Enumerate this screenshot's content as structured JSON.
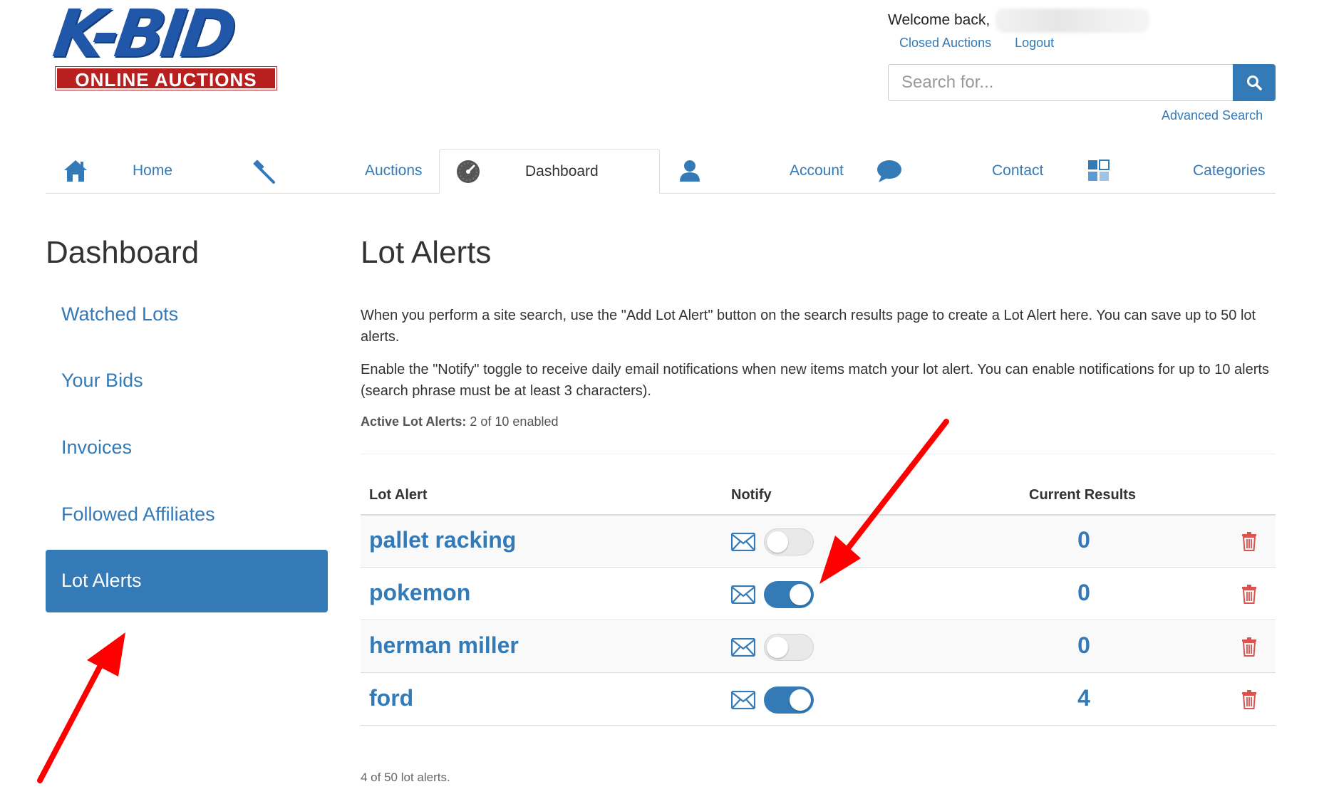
{
  "logo": {
    "main": "K-BID",
    "sub": "ONLINE AUCTIONS"
  },
  "header": {
    "welcome": "Welcome back,",
    "links": {
      "closed": "Closed Auctions",
      "logout": "Logout"
    },
    "search_placeholder": "Search for...",
    "advanced": "Advanced Search"
  },
  "nav": {
    "home": "Home",
    "auctions": "Auctions",
    "dashboard": "Dashboard",
    "account": "Account",
    "contact": "Contact",
    "categories": "Categories"
  },
  "sidebar": {
    "title": "Dashboard",
    "items": [
      {
        "label": "Watched Lots"
      },
      {
        "label": "Your Bids"
      },
      {
        "label": "Invoices"
      },
      {
        "label": "Followed Affiliates"
      },
      {
        "label": "Lot Alerts"
      }
    ],
    "active_index": 4
  },
  "main": {
    "title": "Lot Alerts",
    "para1": "When you perform a site search, use the \"Add Lot Alert\" button on the search results page to create a Lot Alert here. You can save up to 50 lot alerts.",
    "para2": "Enable the \"Notify\" toggle to receive daily email notifications when new items match your lot alert. You can enable notifications for up to 10 alerts (search phrase must be at least 3 characters).",
    "active_label": "Active Lot Alerts:",
    "active_value": "2 of 10 enabled",
    "table": {
      "headers": {
        "alert": "Lot Alert",
        "notify": "Notify",
        "results": "Current Results"
      },
      "rows": [
        {
          "name": "pallet racking",
          "notify": false,
          "results": "0"
        },
        {
          "name": "pokemon",
          "notify": true,
          "results": "0"
        },
        {
          "name": "herman miller",
          "notify": false,
          "results": "0"
        },
        {
          "name": "ford",
          "notify": true,
          "results": "4"
        }
      ]
    },
    "footer": "4 of 50 lot alerts."
  },
  "colors": {
    "primary": "#337ab7",
    "annotation_arrow": "#ff0000",
    "trash": "#d9534f"
  },
  "icons": {
    "home": "home-icon",
    "auctions": "gavel-icon",
    "dashboard": "speedometer-icon",
    "account": "user-icon",
    "contact": "chat-bubble-icon",
    "categories": "grid-icon",
    "search": "magnifier-icon",
    "mail": "envelope-icon",
    "delete": "trash-icon"
  }
}
